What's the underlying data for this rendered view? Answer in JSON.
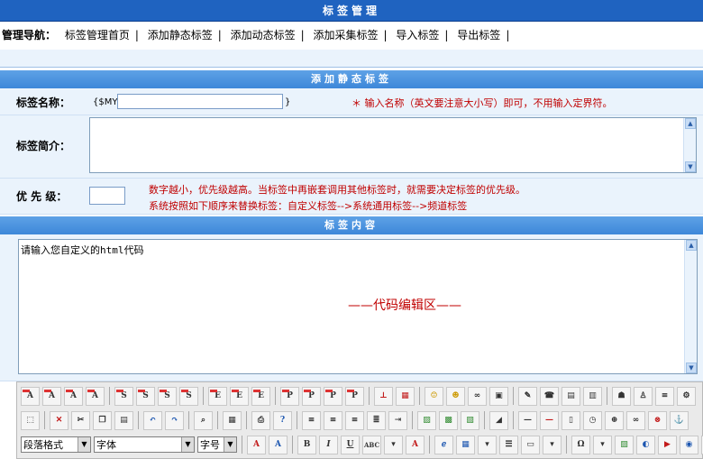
{
  "title": "标签管理",
  "nav": {
    "label": "管理导航：",
    "links": [
      "标签管理首页",
      "添加静态标签",
      "添加动态标签",
      "添加采集标签",
      "导入标签",
      "导出标签"
    ]
  },
  "section_add": "添加静态标签",
  "form": {
    "name_label": "标签名称：",
    "name_prefix": "{$MY_",
    "name_suffix": "}",
    "name_hint": "＊ 输入名称（英文要注意大小写）即可，不用输入定界符。",
    "intro_label": "标签简介：",
    "priority_label": "优 先 级：",
    "priority_hint_1": "数字越小，优先级越高。当标签中再嵌套调用其他标签时，就需要决定标签的优先级。",
    "priority_hint_2": "系统按照如下顺序来替换标签：自定义标签-->系统通用标签-->频道标签"
  },
  "section_content": "标签内容",
  "editor": {
    "placeholder": "请输入您自定义的html代码",
    "center_label": "——代码编辑区——"
  },
  "toolbar": {
    "paragraph_select": "段落格式",
    "font_select": "字体",
    "size_select": "字号"
  }
}
